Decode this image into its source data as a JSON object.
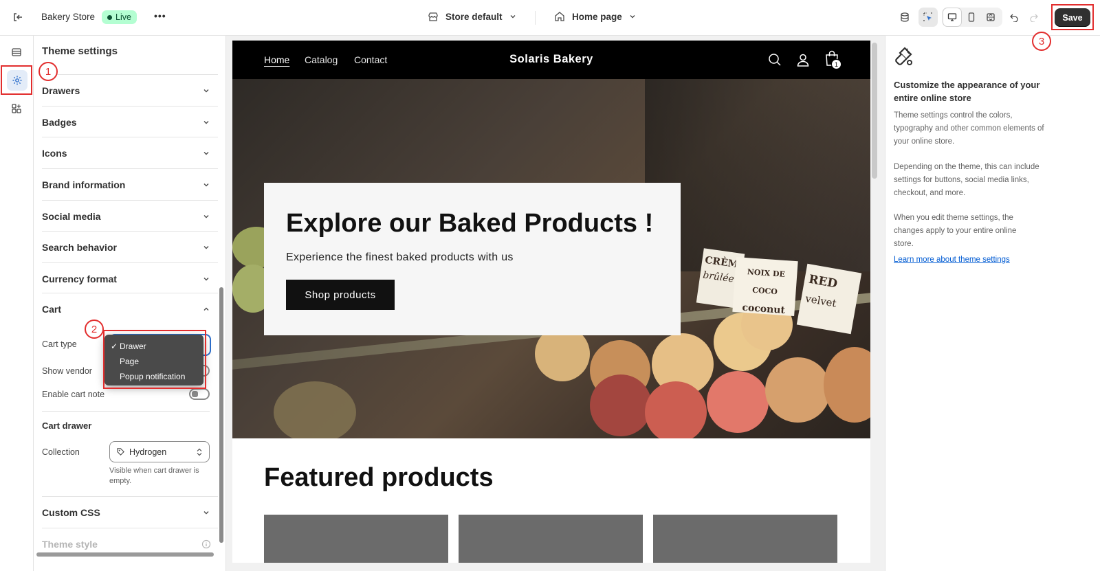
{
  "topbar": {
    "store_name": "Bakery Store",
    "live_badge": "Live",
    "more": "•••",
    "store_selector": "Store default",
    "page_selector": "Home page",
    "save_label": "Save"
  },
  "panel": {
    "title": "Theme settings",
    "sections": [
      "Drawers",
      "Badges",
      "Icons",
      "Brand information",
      "Social media",
      "Search behavior",
      "Currency format"
    ],
    "cart": {
      "title": "Cart",
      "cart_type_label": "Cart type",
      "cart_type_options": [
        "Drawer",
        "Page",
        "Popup notification"
      ],
      "cart_type_selected": "Drawer",
      "show_vendor_label": "Show vendor",
      "cart_note_label": "Enable cart note",
      "cart_drawer_heading": "Cart drawer",
      "collection_label": "Collection",
      "collection_value": "Hydrogen",
      "collection_help": "Visible when cart drawer is empty."
    },
    "custom_css": "Custom CSS",
    "theme_style": "Theme style"
  },
  "store": {
    "nav": [
      "Home",
      "Catalog",
      "Contact"
    ],
    "brand": "Solaris Bakery",
    "cart_count": "1",
    "hero_title": "Explore our Baked Products !",
    "hero_subtitle": "Experience the finest baked products with us",
    "hero_button": "Shop products",
    "signs": [
      "CRÈME",
      "brûlée",
      "NOIX DE COCO",
      "coconut",
      "RED",
      "velvet"
    ],
    "featured_title": "Featured products"
  },
  "right_panel": {
    "heading": "Customize the appearance of your entire online store",
    "p1": "Theme settings control the colors, typography and other common elements of your online store.",
    "p2": "Depending on the theme, this can include settings for buttons, social media links, checkout, and more.",
    "p3": "When you edit theme settings, the changes apply to your entire online store.",
    "link": "Learn more about theme settings"
  },
  "markers": [
    "1",
    "2",
    "3"
  ],
  "colors": {
    "accent_red": "#e22d2d",
    "live_green": "#b4fed2",
    "save_bg": "#303030"
  }
}
